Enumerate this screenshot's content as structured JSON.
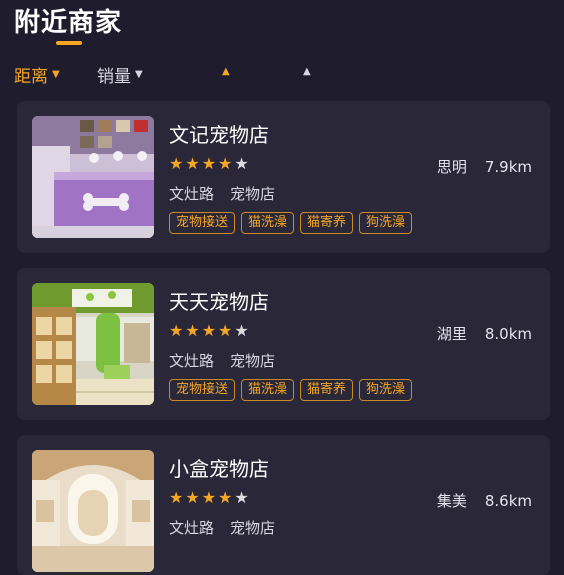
{
  "header": {
    "title": "附近商家"
  },
  "filters": [
    {
      "label": "距离",
      "active": true
    },
    {
      "label": "销量",
      "active": false
    }
  ],
  "colors": {
    "accent": "#f5a623",
    "background": "#1f1c2e",
    "card": "#2a2739"
  },
  "icons": {
    "star": "star-icon",
    "caret_down": "caret-down-icon",
    "caret_up": "caret-up-icon"
  },
  "shops": [
    {
      "name": "文记宠物店",
      "rating": 4.5,
      "district": "思明",
      "distance": "7.9km",
      "road": "文灶路",
      "category": "宠物店",
      "tags": [
        "宠物接送",
        "猫洗澡",
        "猫寄养",
        "狗洗澡"
      ]
    },
    {
      "name": "天天宠物店",
      "rating": 4.5,
      "district": "湖里",
      "distance": "8.0km",
      "road": "文灶路",
      "category": "宠物店",
      "tags": [
        "宠物接送",
        "猫洗澡",
        "猫寄养",
        "狗洗澡"
      ]
    },
    {
      "name": "小盒宠物店",
      "rating": 4.5,
      "district": "集美",
      "distance": "8.6km",
      "road": "文灶路",
      "category": "宠物店",
      "tags": []
    }
  ]
}
